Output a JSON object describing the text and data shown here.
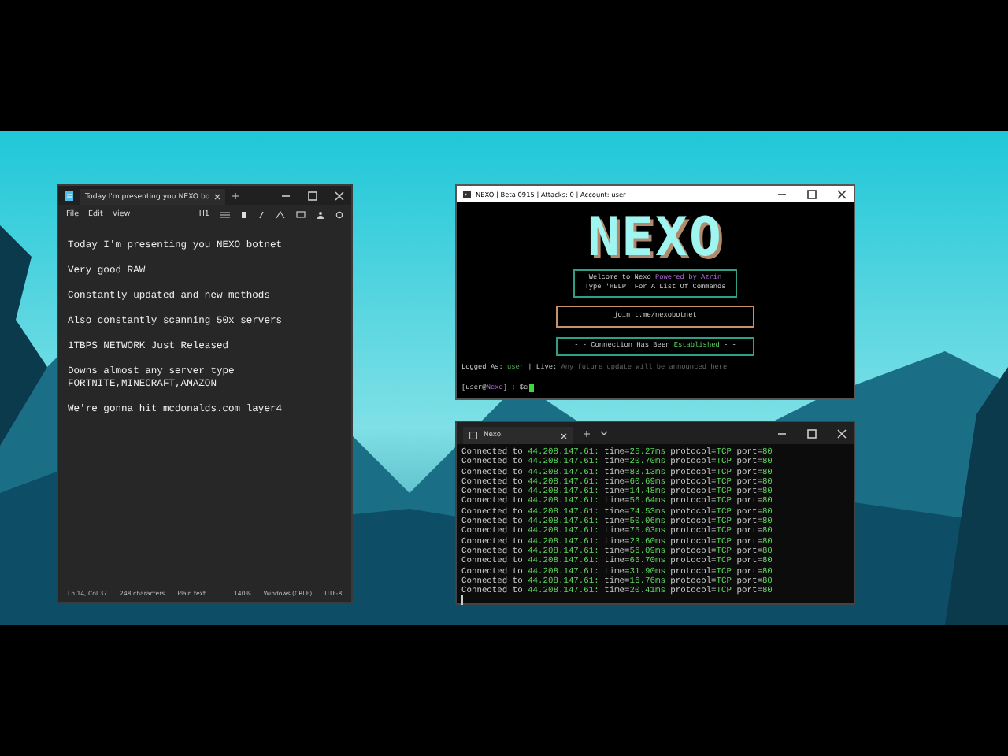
{
  "notepad": {
    "tab_title": "Today I'm presenting you NEXO bo",
    "menu": [
      "File",
      "Edit",
      "View"
    ],
    "heading_button": "H1",
    "paragraphs": [
      "Today I'm presenting you NEXO botnet",
      "Very good RAW",
      "Constantly updated and new methods",
      "Also constantly scanning 50x servers",
      "1TBPS NETWORK Just Released",
      "Downs almost any server type\nFORTNITE,MINECRAFT,AMAZON",
      "We're gonna hit mcdonalds.com layer4"
    ],
    "status_bar": [
      "Ln 14, Col 37",
      "248 characters",
      "Plain text",
      "140%",
      "Windows (CRLF)",
      "UTF-8"
    ]
  },
  "console": {
    "title": "NEXO | Beta 0915 | Attacks: 0 | Account: user",
    "logo": "NEXO",
    "welcome": "Welcome to Nexo",
    "powered": "Powered by Azrin",
    "help": "Type 'HELP' For A List Of Commands",
    "join": "join t.me/nexobotnet",
    "connection_prefix": "- - Connection Has Been",
    "connection_status": "Established",
    "connection_suffix": "- -",
    "logged_label": "Logged As:",
    "user": "user",
    "live_label": "| Live:",
    "announcement": "Any future update will be announced here",
    "prompt_user": "[user@",
    "prompt_host": "Nexo",
    "prompt_end": "] : $",
    "input": "c"
  },
  "output": {
    "tab_title": "Nexo.",
    "lines": [
      {
        "prefix": "Connected to",
        "ip": "44.208.147.61:",
        "time_key": "time=",
        "time": "25.27ms",
        "protocol_key": "protocol=",
        "protocol": "TCP",
        "port_key": "port=",
        "port": "80"
      },
      {
        "prefix": "Connected to",
        "ip": "44.208.147.61:",
        "time_key": "time=",
        "time": "20.70ms",
        "protocol_key": "protocol=",
        "protocol": "TCP",
        "port_key": "port=",
        "port": "80"
      },
      {
        "prefix": "Connected to",
        "ip": "44.208.147.61:",
        "time_key": "time=",
        "time": "83.13ms",
        "protocol_key": "protocol=",
        "protocol": "TCP",
        "port_key": "port=",
        "port": "80"
      },
      {
        "prefix": "Connected to",
        "ip": "44.208.147.61:",
        "time_key": "time=",
        "time": "60.69ms",
        "protocol_key": "protocol=",
        "protocol": "TCP",
        "port_key": "port=",
        "port": "80"
      },
      {
        "prefix": "Connected to",
        "ip": "44.208.147.61:",
        "time_key": "time=",
        "time": "14.48ms",
        "protocol_key": "protocol=",
        "protocol": "TCP",
        "port_key": "port=",
        "port": "80"
      },
      {
        "prefix": "Connected to",
        "ip": "44.208.147.61:",
        "time_key": "time=",
        "time": "56.64ms",
        "protocol_key": "protocol=",
        "protocol": "TCP",
        "port_key": "port=",
        "port": "80"
      },
      {
        "prefix": "Connected to",
        "ip": "44.208.147.61:",
        "time_key": "time=",
        "time": "74.53ms",
        "protocol_key": "protocol=",
        "protocol": "TCP",
        "port_key": "port=",
        "port": "80"
      },
      {
        "prefix": "Connected to",
        "ip": "44.208.147.61:",
        "time_key": "time=",
        "time": "50.06ms",
        "protocol_key": "protocol=",
        "protocol": "TCP",
        "port_key": "port=",
        "port": "80"
      },
      {
        "prefix": "Connected to",
        "ip": "44.208.147.61:",
        "time_key": "time=",
        "time": "75.03ms",
        "protocol_key": "protocol=",
        "protocol": "TCP",
        "port_key": "port=",
        "port": "80"
      },
      {
        "prefix": "Connected to",
        "ip": "44.208.147.61:",
        "time_key": "time=",
        "time": "23.60ms",
        "protocol_key": "protocol=",
        "protocol": "TCP",
        "port_key": "port=",
        "port": "80"
      },
      {
        "prefix": "Connected to",
        "ip": "44.208.147.61:",
        "time_key": "time=",
        "time": "56.09ms",
        "protocol_key": "protocol=",
        "protocol": "TCP",
        "port_key": "port=",
        "port": "80"
      },
      {
        "prefix": "Connected to",
        "ip": "44.208.147.61:",
        "time_key": "time=",
        "time": "65.70ms",
        "protocol_key": "protocol=",
        "protocol": "TCP",
        "port_key": "port=",
        "port": "80"
      },
      {
        "prefix": "Connected to",
        "ip": "44.208.147.61:",
        "time_key": "time=",
        "time": "31.90ms",
        "protocol_key": "protocol=",
        "protocol": "TCP",
        "port_key": "port=",
        "port": "80"
      },
      {
        "prefix": "Connected to",
        "ip": "44.208.147.61:",
        "time_key": "time=",
        "time": "16.76ms",
        "protocol_key": "protocol=",
        "protocol": "TCP",
        "port_key": "port=",
        "port": "80"
      },
      {
        "prefix": "Connected to",
        "ip": "44.208.147.61:",
        "time_key": "time=",
        "time": "20.41ms",
        "protocol_key": "protocol=",
        "protocol": "TCP",
        "port_key": "port=",
        "port": "80"
      }
    ]
  }
}
